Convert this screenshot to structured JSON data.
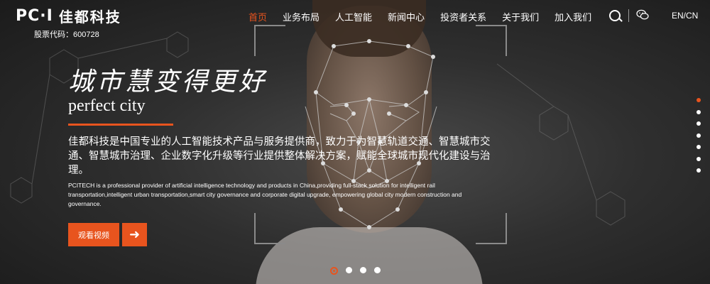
{
  "header": {
    "logo_mark": "PC·I",
    "logo_name": "佳都科技",
    "stock_code": "股票代码：600728",
    "nav": [
      {
        "label": "首页",
        "active": true
      },
      {
        "label": "业务布局"
      },
      {
        "label": "人工智能"
      },
      {
        "label": "新闻中心"
      },
      {
        "label": "投资者关系"
      },
      {
        "label": "关于我们"
      },
      {
        "label": "加入我们"
      }
    ],
    "search_icon": "search-icon",
    "wechat_icon": "wechat-icon",
    "lang": "EN/CN"
  },
  "hero": {
    "slogan": "城市慧变得更好",
    "subtitle": "perfect city",
    "desc_cn": "佳都科技是中国专业的人工智能技术产品与服务提供商，致力于为智慧轨道交通、智慧城市交通、智慧城市治理、企业数字化升级等行业提供整体解决方案，赋能全球城市现代化建设与治理。",
    "desc_en": "PCITECH is a professional provider of artificial intelligence technology and products in China,providing full-stack solution for intelligent rail transportation,intelligent urban transportation,smart city governance and corporate digital upgrade, empowering global city modern construction and governance.",
    "watch_button": "观看视频",
    "arrow_icon": "arrow-right-icon"
  },
  "colors": {
    "accent": "#e8541e"
  },
  "pager_horizontal": {
    "count": 4,
    "active": 0
  },
  "pager_vertical": {
    "count": 7,
    "active": 0
  }
}
